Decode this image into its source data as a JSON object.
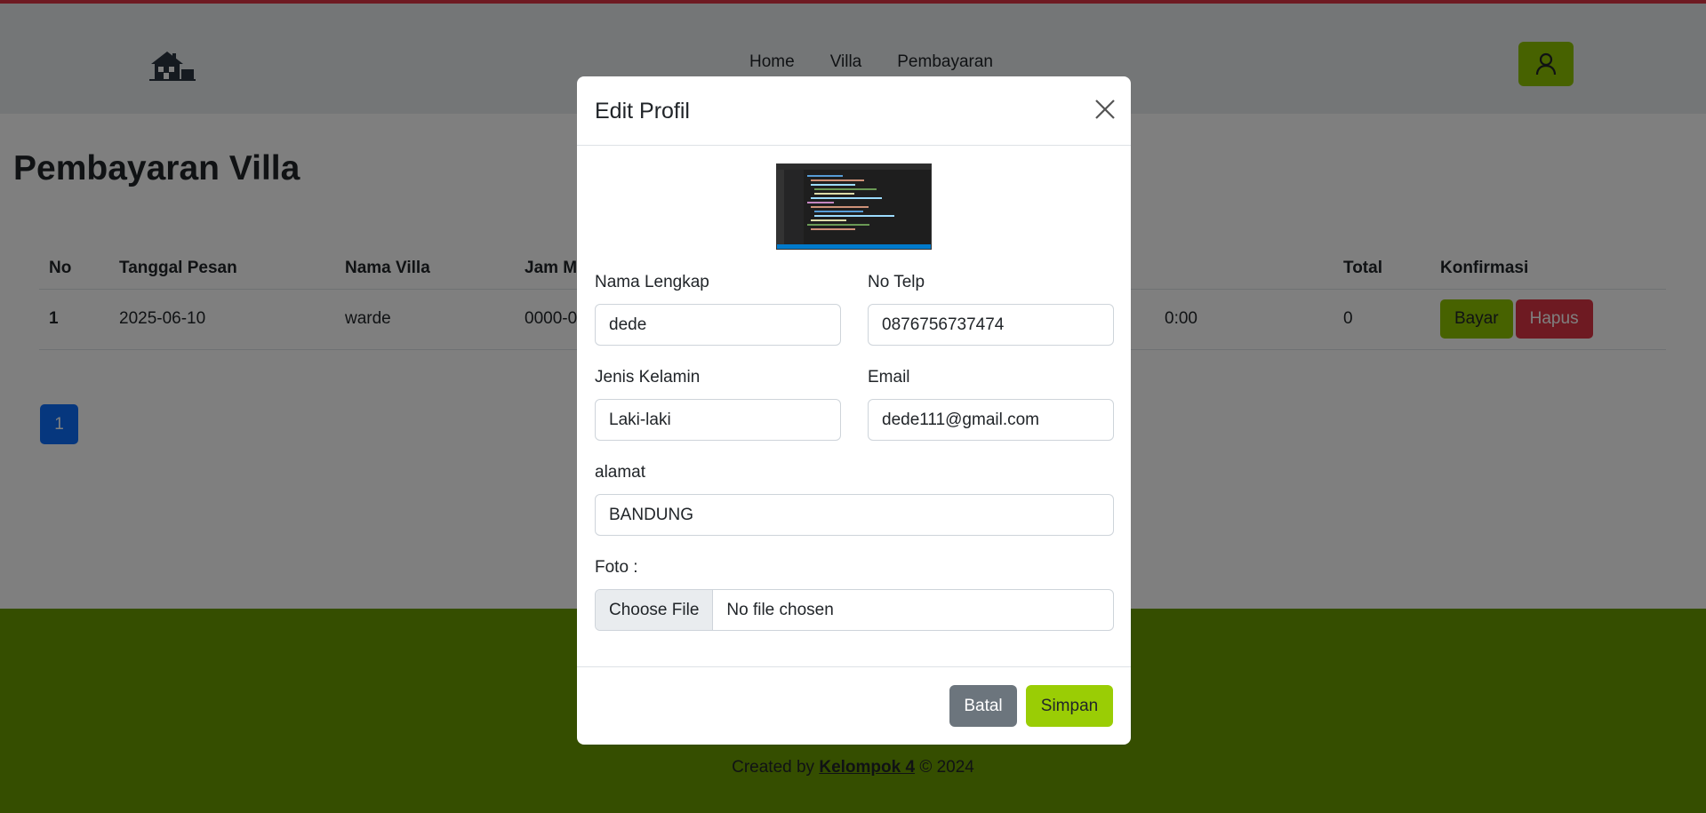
{
  "nav": {
    "links": [
      "Home",
      "Villa",
      "Pembayaran"
    ]
  },
  "page": {
    "title": "Pembayaran Villa"
  },
  "table": {
    "headers": [
      "No",
      "Tanggal Pesan",
      "Nama Villa",
      "Jam M",
      "",
      "Total",
      "Konfirmasi"
    ],
    "rows": [
      {
        "no": "1",
        "tanggal": "2025-06-10",
        "villa": "warde",
        "jam": "0000-0",
        "hidden": "0:00",
        "total": "0"
      }
    ],
    "bayar_label": "Bayar",
    "hapus_label": "Hapus"
  },
  "pagination": {
    "current": "1"
  },
  "footer": {
    "prefix": "Created by ",
    "link": "Kelompok 4",
    "suffix": " © 2024"
  },
  "modal": {
    "title": "Edit Profil",
    "fields": {
      "nama_label": "Nama Lengkap",
      "nama_value": "dede",
      "telp_label": "No Telp",
      "telp_value": "0876756737474",
      "jk_label": "Jenis Kelamin",
      "jk_value": "Laki-laki",
      "email_label": "Email",
      "email_value": "dede111@gmail.com",
      "alamat_label": "alamat",
      "alamat_value": "BANDUNG",
      "foto_label": "Foto :",
      "file_button": "Choose File",
      "file_name": "No file chosen"
    },
    "batal_label": "Batal",
    "simpan_label": "Simpan"
  },
  "colors": {
    "accent_green": "#8fc400",
    "footer_green": "#6a9c00",
    "danger": "#dc3545",
    "primary": "#0d6efd",
    "secondary": "#6c757d"
  }
}
